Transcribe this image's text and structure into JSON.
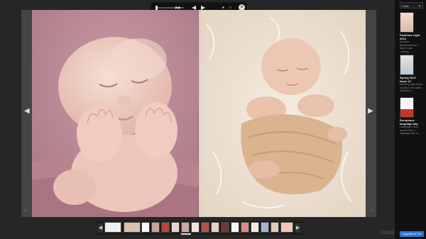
{
  "toolbar": {
    "icons": [
      "seek-slider",
      "fast-forward-icon",
      "previous-icon",
      "play-icon",
      "grid-icon",
      "fullscreen-icon",
      "close-icon"
    ]
  },
  "pages": {
    "left": {
      "description_icon": "photo-of-baby-on-pink-blanket"
    },
    "right": {
      "description_icon": "photo-of-baby-on-white-fur"
    }
  },
  "nav": {
    "prev_glyph": "◀",
    "next_glyph": "▶",
    "first_glyph": "⇤",
    "last_glyph": "⇥"
  },
  "thumbnails": {
    "count": 19,
    "active_index": 9,
    "prev_glyph": "◀",
    "next_glyph": "▶"
  },
  "brand": "issuu",
  "sidebar": {
    "select_value": "Smile",
    "items": [
      {
        "title": "Fashions Light 2013",
        "desc": "Sandeep Bhantmawinda a lasers wasn Looking..."
      },
      {
        "title": "Spring 2012 Issue 22",
        "desc": "Wedding style Stone peaces to the latest inspiration..."
      },
      {
        "title": "Europeans language day",
        "desc": "Language theme annual Talk a language day on..."
      }
    ],
    "upgrade_label": "Upgrade to Pro"
  }
}
